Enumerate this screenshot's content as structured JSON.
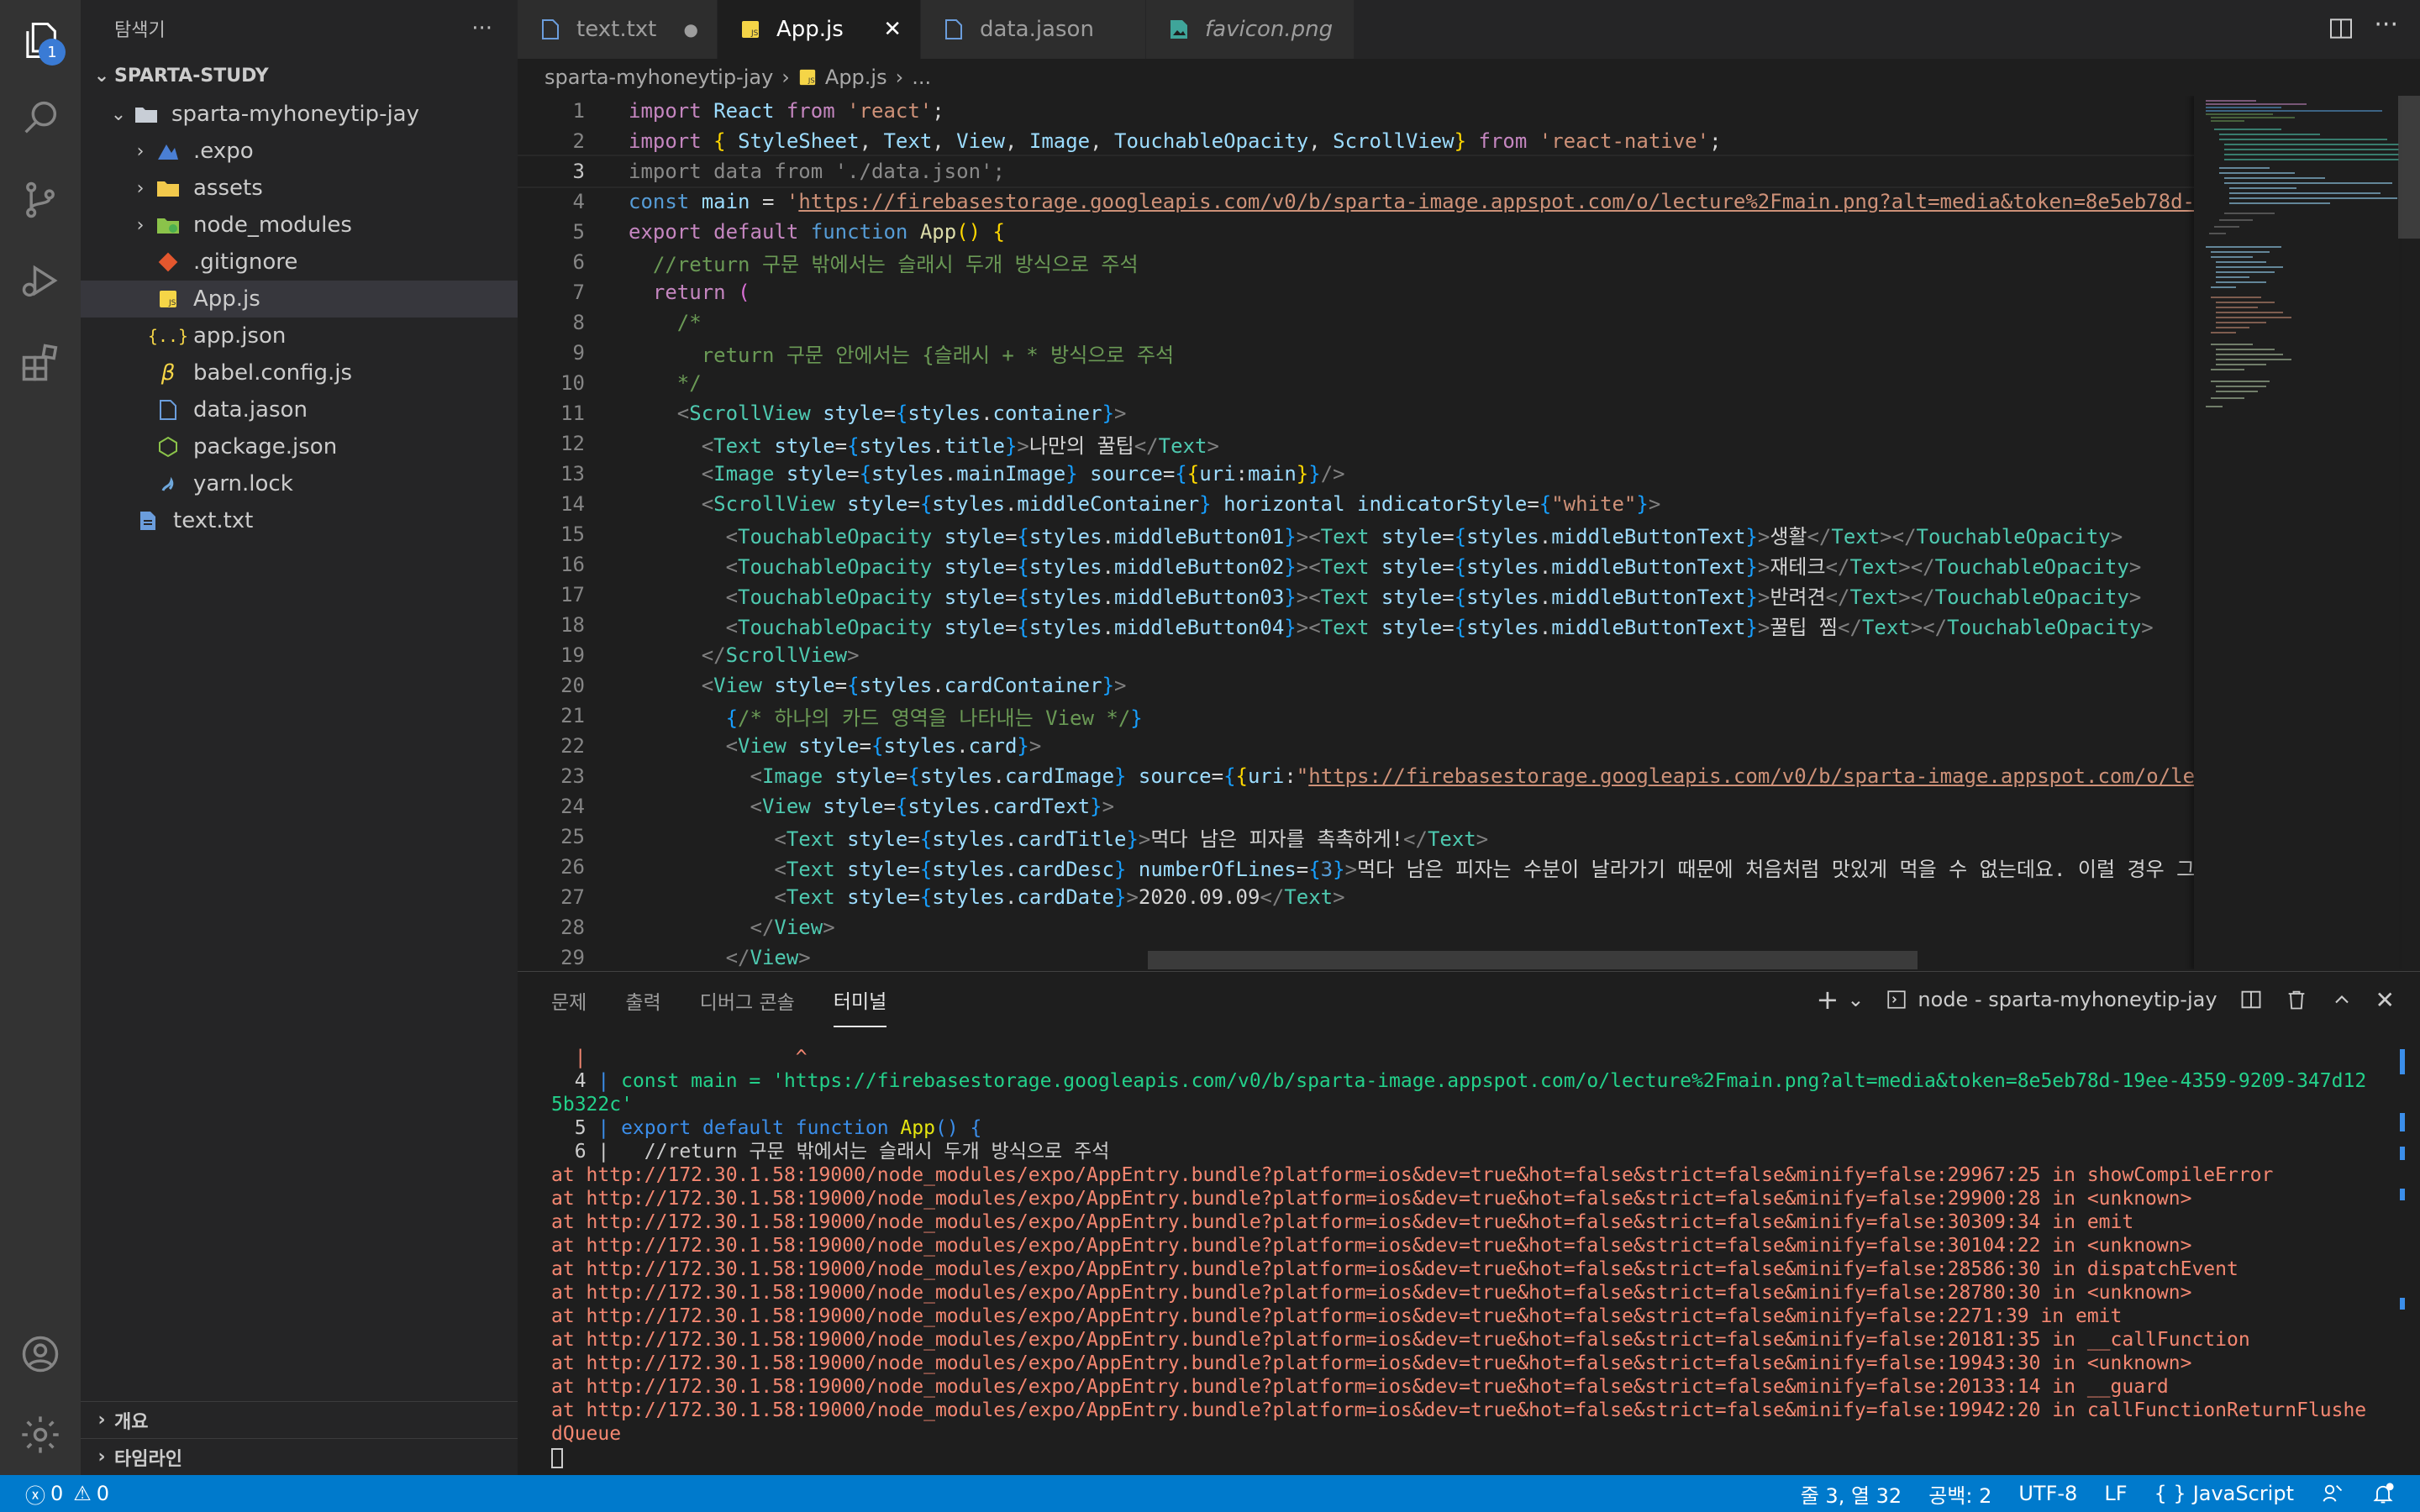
{
  "activity": {
    "badge": "1",
    "icons": [
      "explorer-icon",
      "search-icon",
      "source-control-icon",
      "run-debug-icon",
      "extensions-icon",
      "account-icon",
      "gear-icon"
    ]
  },
  "sidebar": {
    "title": "탐색기",
    "more": "···",
    "root": "SPARTA-STUDY",
    "items": [
      {
        "label": "sparta-myhoneytip-jay"
      },
      {
        "label": ".expo"
      },
      {
        "label": "assets"
      },
      {
        "label": "node_modules"
      },
      {
        "label": ".gitignore"
      },
      {
        "label": "App.js"
      },
      {
        "label": "app.json"
      },
      {
        "label": "babel.config.js"
      },
      {
        "label": "data.jason"
      },
      {
        "label": "package.json"
      },
      {
        "label": "yarn.lock"
      },
      {
        "label": "text.txt"
      }
    ],
    "outline": "개요",
    "timeline": "타임라인"
  },
  "tabs": [
    {
      "label": "text.txt",
      "dirty": "●"
    },
    {
      "label": "App.js",
      "close": "✕"
    },
    {
      "label": "data.jason"
    },
    {
      "label": "favicon.png"
    }
  ],
  "breadcrumb": {
    "folder": "sparta-myhoneytip-jay",
    "file": "App.js",
    "more": "..."
  },
  "editor": {
    "line_numbers": [
      "1",
      "2",
      "3",
      "4",
      "5",
      "6",
      "7",
      "8",
      "9",
      "10",
      "11",
      "12",
      "13",
      "14",
      "15",
      "16",
      "17",
      "18",
      "19",
      "20",
      "21",
      "22",
      "23",
      "24",
      "25",
      "26",
      "27",
      "28",
      "29"
    ],
    "current_line": "3"
  },
  "panel": {
    "tabs": [
      "문제",
      "출력",
      "디버그 콘솔",
      "터미널"
    ],
    "active_tab": "터미널",
    "terminal_name": "node - sparta-myhoneytip-jay",
    "terminal": {
      "caret_line": "  |                  ^",
      "code_lines": [
        {
          "no": "  4",
          "text": " | const main = 'https://firebasestorage.googleapis.com/v0/b/sparta-image.appspot.com/o/lecture%2Fmain.png?alt=media&token=8e5eb78d-19ee-4359-9209-347d12"
        },
        {
          "no": "",
          "text": "5b322c'"
        },
        {
          "no": "  5",
          "text": " | export default function App() {"
        },
        {
          "no": "  6",
          "text": " |   //return 구문 밖에서는 슬래시 두개 방식으로 주석"
        }
      ],
      "stack": [
        "at http://172.30.1.58:19000/node_modules/expo/AppEntry.bundle?platform=ios&dev=true&hot=false&strict=false&minify=false:29967:25 in showCompileError",
        "at http://172.30.1.58:19000/node_modules/expo/AppEntry.bundle?platform=ios&dev=true&hot=false&strict=false&minify=false:29900:28 in <unknown>",
        "at http://172.30.1.58:19000/node_modules/expo/AppEntry.bundle?platform=ios&dev=true&hot=false&strict=false&minify=false:30309:34 in emit",
        "at http://172.30.1.58:19000/node_modules/expo/AppEntry.bundle?platform=ios&dev=true&hot=false&strict=false&minify=false:30104:22 in <unknown>",
        "at http://172.30.1.58:19000/node_modules/expo/AppEntry.bundle?platform=ios&dev=true&hot=false&strict=false&minify=false:28586:30 in dispatchEvent",
        "at http://172.30.1.58:19000/node_modules/expo/AppEntry.bundle?platform=ios&dev=true&hot=false&strict=false&minify=false:28780:30 in <unknown>",
        "at http://172.30.1.58:19000/node_modules/expo/AppEntry.bundle?platform=ios&dev=true&hot=false&strict=false&minify=false:2271:39 in emit",
        "at http://172.30.1.58:19000/node_modules/expo/AppEntry.bundle?platform=ios&dev=true&hot=false&strict=false&minify=false:20181:35 in __callFunction",
        "at http://172.30.1.58:19000/node_modules/expo/AppEntry.bundle?platform=ios&dev=true&hot=false&strict=false&minify=false:19943:30 in <unknown>",
        "at http://172.30.1.58:19000/node_modules/expo/AppEntry.bundle?platform=ios&dev=true&hot=false&strict=false&minify=false:20133:14 in __guard",
        "at http://172.30.1.58:19000/node_modules/expo/AppEntry.bundle?platform=ios&dev=true&hot=false&strict=false&minify=false:19942:20 in callFunctionReturnFlushe",
        "dQueue"
      ]
    }
  },
  "status": {
    "errors": "0",
    "warnings": "0",
    "position": "줄 3, 열 32",
    "spaces": "공백: 2",
    "encoding": "UTF-8",
    "eol": "LF",
    "language": "JavaScript"
  },
  "colors": {
    "status_bar": "#007acc",
    "accent": "#3a7bd5"
  }
}
